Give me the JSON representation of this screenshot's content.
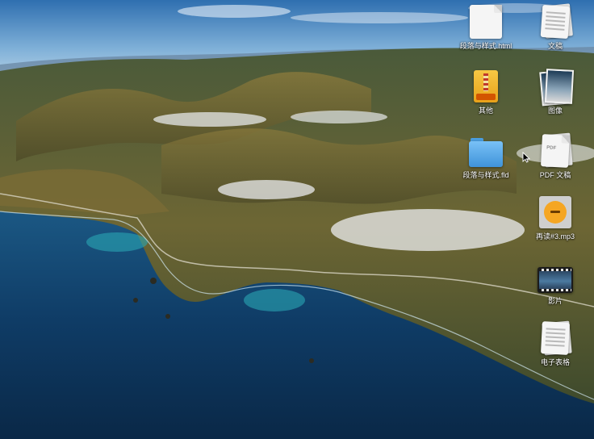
{
  "desktop": {
    "wallpaper": "big-sur-coastline",
    "icons": [
      {
        "label": "段落与样式.html",
        "icon": "html-document-icon"
      },
      {
        "label": "文稿",
        "icon": "documents-stack-icon"
      },
      {
        "label": "其他",
        "icon": "archive-icon"
      },
      {
        "label": "图像",
        "icon": "images-stack-icon"
      },
      {
        "label": "段落与样式.fld",
        "icon": "folder-icon"
      },
      {
        "label": "PDF 文稿",
        "icon": "pdf-document-icon"
      },
      {
        "label": "再读#3.mp3",
        "icon": "mp3-file-icon"
      },
      {
        "label": "影片",
        "icon": "movie-icon"
      },
      {
        "label": "电子表格",
        "icon": "spreadsheet-stack-icon"
      }
    ]
  },
  "colors": {
    "sky_top": "#2f6fb0",
    "ocean": "#0f3c66",
    "land": "#5b5a2f",
    "label_text": "#ffffff"
  }
}
